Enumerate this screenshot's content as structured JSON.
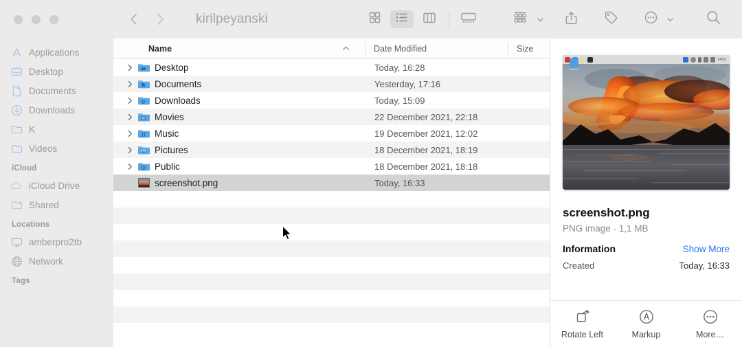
{
  "window": {
    "title": "kirilpeyanski",
    "traffic_lights": [
      "close",
      "minimize",
      "maximize"
    ]
  },
  "toolbar": {
    "back_icon": "chevron-left-icon",
    "forward_icon": "chevron-right-icon",
    "view_buttons": [
      {
        "name": "icon-view",
        "icon": "grid-view-icon",
        "selected": false
      },
      {
        "name": "list-view",
        "icon": "list-view-icon",
        "selected": true
      },
      {
        "name": "column-view",
        "icon": "column-view-icon",
        "selected": false
      },
      {
        "name": "gallery-view",
        "icon": "gallery-view-icon",
        "selected": false
      }
    ],
    "group_by_icon": "group-by-icon",
    "share_icon": "share-icon",
    "tags_icon": "tag-icon",
    "more_icon": "more-circle-icon",
    "search_icon": "search-icon"
  },
  "sidebar": {
    "favorites": [
      {
        "label": "Applications",
        "icon": "applications-icon"
      },
      {
        "label": "Desktop",
        "icon": "desktop-icon"
      },
      {
        "label": "Documents",
        "icon": "document-icon"
      },
      {
        "label": "Downloads",
        "icon": "downloads-icon"
      },
      {
        "label": "K",
        "icon": "folder-icon"
      },
      {
        "label": "Videos",
        "icon": "folder-icon"
      }
    ],
    "icloud_header": "iCloud",
    "icloud": [
      {
        "label": "iCloud Drive",
        "icon": "cloud-icon"
      },
      {
        "label": "Shared",
        "icon": "shared-folder-icon"
      }
    ],
    "locations_header": "Locations",
    "locations": [
      {
        "label": "amberpro2tb",
        "icon": "display-icon"
      },
      {
        "label": "Network",
        "icon": "globe-icon"
      }
    ],
    "tags_header": "Tags"
  },
  "filelist": {
    "columns": {
      "name": "Name",
      "date_modified": "Date Modified",
      "size": "Size"
    },
    "sort_column": "Name",
    "sort_direction": "ascending",
    "rows": [
      {
        "name": "Desktop",
        "date": "Today, 16:28",
        "size": "",
        "kind": "folder",
        "badge": "desktop",
        "expandable": true,
        "selected": false
      },
      {
        "name": "Documents",
        "date": "Yesterday, 17:16",
        "size": "",
        "kind": "folder",
        "badge": "document",
        "expandable": true,
        "selected": false
      },
      {
        "name": "Downloads",
        "date": "Today, 15:09",
        "size": "",
        "kind": "folder",
        "badge": "download",
        "expandable": true,
        "selected": false
      },
      {
        "name": "Movies",
        "date": "22 December 2021, 22:18",
        "size": "",
        "kind": "folder",
        "badge": "movie",
        "expandable": true,
        "selected": false
      },
      {
        "name": "Music",
        "date": "19 December 2021, 12:02",
        "size": "",
        "kind": "folder",
        "badge": "music",
        "expandable": true,
        "selected": false
      },
      {
        "name": "Pictures",
        "date": "18 December 2021, 18:19",
        "size": "",
        "kind": "folder",
        "badge": "picture",
        "expandable": true,
        "selected": false
      },
      {
        "name": "Public",
        "date": "18 December 2021, 18:18",
        "size": "",
        "kind": "folder",
        "badge": "public",
        "expandable": true,
        "selected": false
      },
      {
        "name": "screenshot.png",
        "date": "Today, 16:33",
        "size": "",
        "kind": "image",
        "badge": "",
        "expandable": false,
        "selected": true
      }
    ],
    "empty_row_count": 9
  },
  "preview": {
    "thumbnail_alt": "sunset-clouds-over-water-screenshot",
    "thumbnail_menubar_time": "14:53",
    "thumbnail_trash_label": "Кошчето",
    "file_name": "screenshot.png",
    "file_meta": "PNG image - 1,1 MB",
    "information_heading": "Information",
    "show_more_label": "Show More",
    "created_label": "Created",
    "created_value": "Today, 16:33",
    "actions": [
      {
        "label": "Rotate Left",
        "icon": "rotate-left-icon"
      },
      {
        "label": "Markup",
        "icon": "markup-icon"
      },
      {
        "label": "More…",
        "icon": "more-circle-icon"
      }
    ]
  },
  "colors": {
    "chrome": "#eceaea",
    "accent_link": "#2878e8",
    "folder_blue": "#5aa7e8",
    "selected_row": "#d3d3d3"
  }
}
